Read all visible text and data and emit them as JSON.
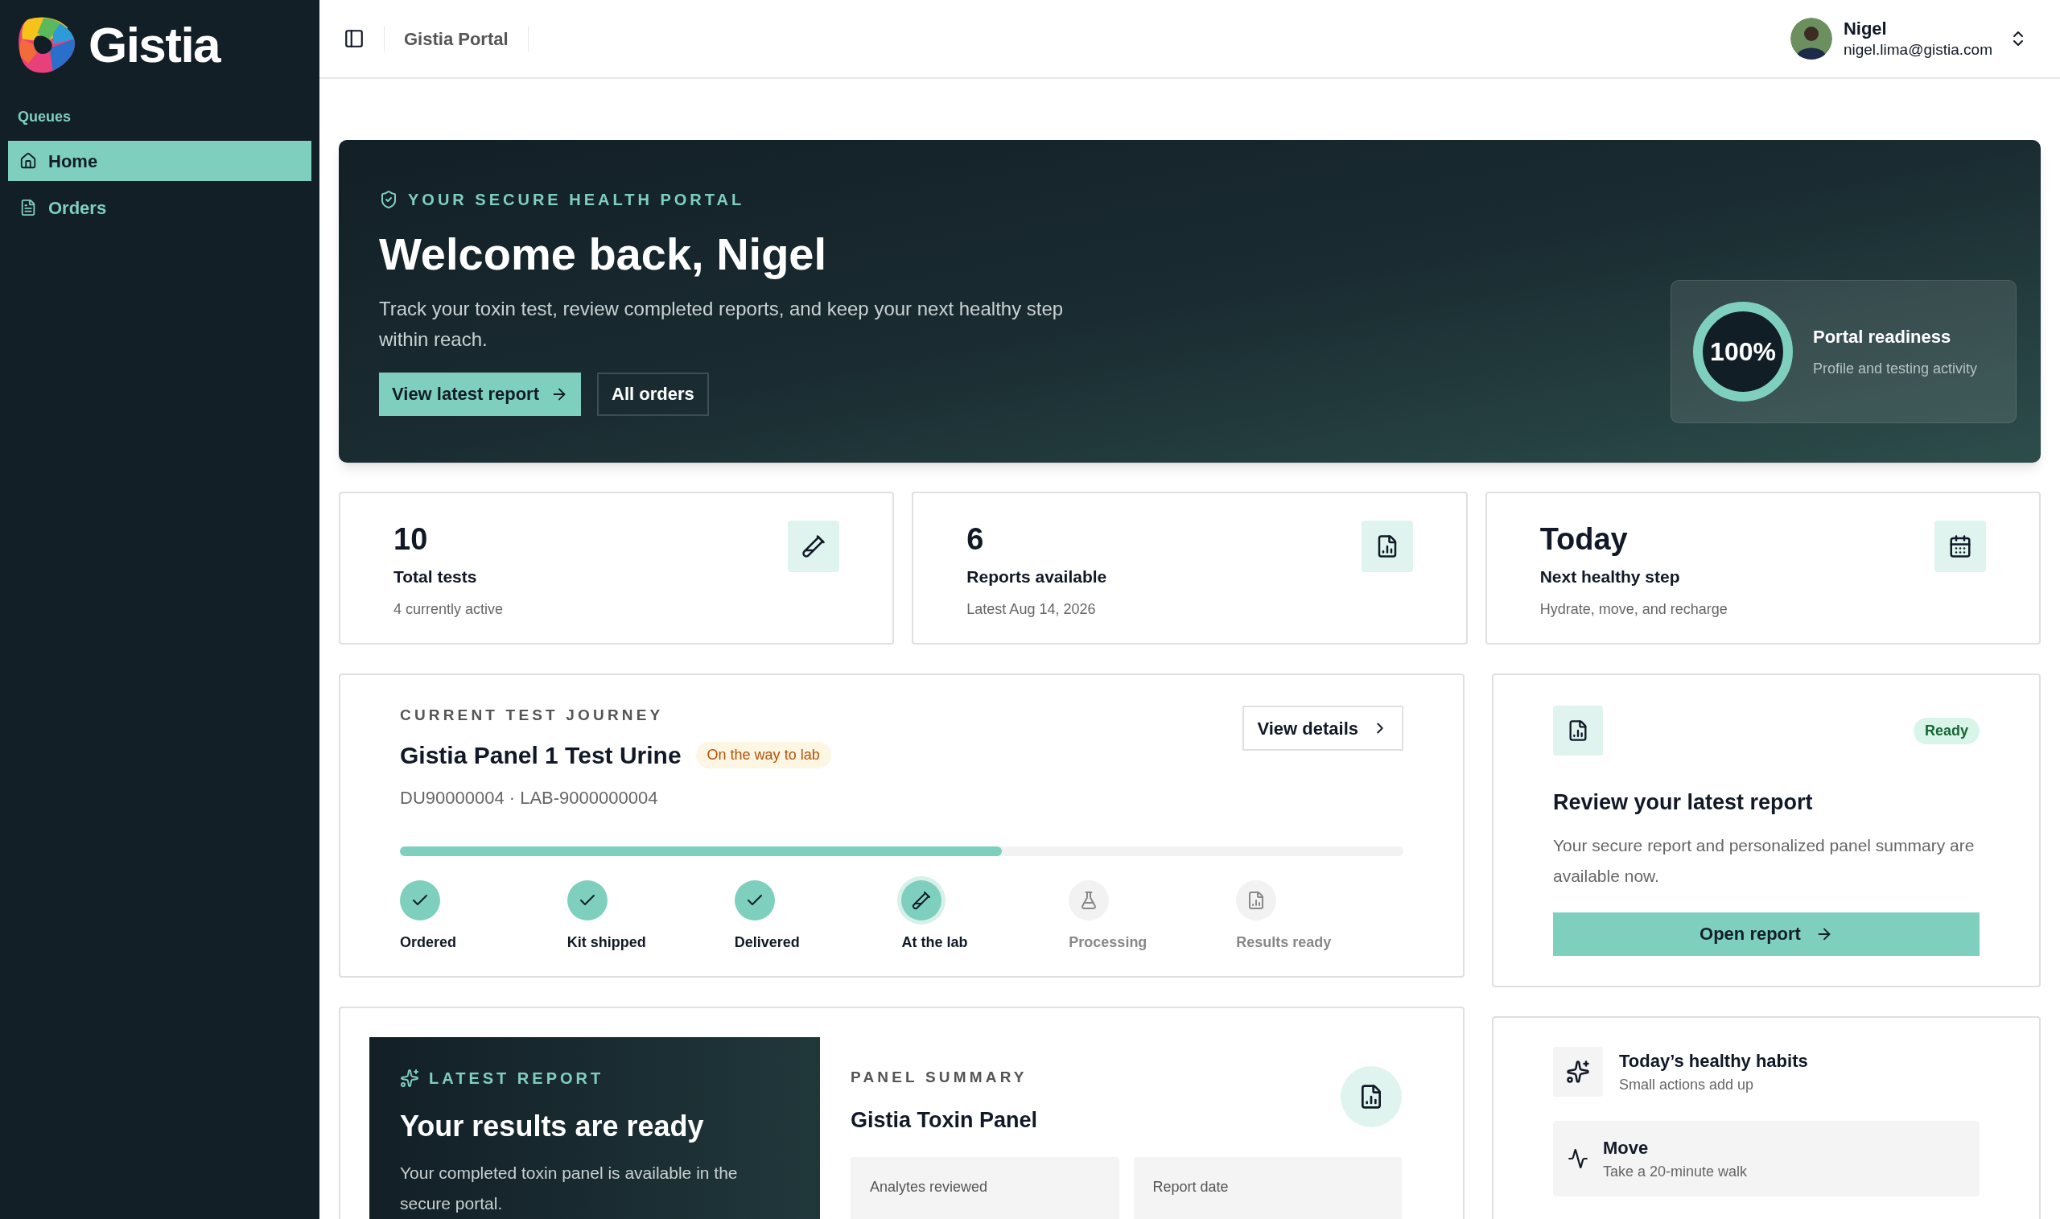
{
  "sidebar": {
    "brand": "Gistia",
    "section": "Queues",
    "items": [
      {
        "label": "Home",
        "kind": "home",
        "selected": true
      },
      {
        "label": "Orders",
        "kind": "orders",
        "selected": false
      }
    ]
  },
  "header": {
    "title": "Gistia Portal",
    "user": {
      "name": "Nigel",
      "email": "nigel.lima@gistia.com"
    }
  },
  "hero": {
    "eyebrow": "YOUR SECURE HEALTH PORTAL",
    "title": "Welcome back, Nigel",
    "text": "Track your toxin test, review completed reports, and keep your next healthy step within reach.",
    "primary_button": "View latest report",
    "secondary_button": "All orders",
    "readiness": {
      "value": "100%",
      "level": 1,
      "title": "Portal readiness",
      "subtitle": "Profile and testing activity"
    }
  },
  "stats": [
    {
      "value": "10",
      "label": "Total tests",
      "sub": "4 currently active",
      "kind": "tube"
    },
    {
      "value": "6",
      "label": "Reports available",
      "sub": "Latest Aug 14, 2026",
      "kind": "report"
    },
    {
      "value": "Today",
      "label": "Next healthy step",
      "sub": "Hydrate, move, and recharge",
      "kind": "calendar"
    }
  ],
  "journey": {
    "eyebrow": "CURRENT TEST JOURNEY",
    "title": "Gistia Panel 1 Test Urine",
    "badge": "On the way to lab",
    "ids": "DU90000004 · LAB-9000000004",
    "button": "View details",
    "level": 0.6,
    "steps": [
      {
        "label": "Ordered",
        "kind": "done"
      },
      {
        "label": "Kit shipped",
        "kind": "done"
      },
      {
        "label": "Delivered",
        "kind": "done"
      },
      {
        "label": "At the lab",
        "kind": "current"
      },
      {
        "label": "Processing",
        "kind": "pending"
      },
      {
        "label": "Results ready",
        "kind": "pending"
      }
    ]
  },
  "review": {
    "badge": "Ready",
    "title": "Review your latest report",
    "text": "Your secure report and personalized panel summary are available now.",
    "button": "Open report"
  },
  "latest": {
    "eyebrow": "LATEST REPORT",
    "title": "Your results are ready",
    "text": "Your completed toxin panel is available in the secure portal.",
    "summary_eyebrow": "PANEL SUMMARY",
    "summary_title": "Gistia Toxin Panel",
    "fields": [
      "Analytes reviewed",
      "Report date"
    ]
  },
  "habits": {
    "title": "Today’s healthy habits",
    "subtitle": "Small actions add up",
    "items": [
      {
        "title": "Move",
        "text": "Take a 20-minute walk"
      }
    ]
  }
}
